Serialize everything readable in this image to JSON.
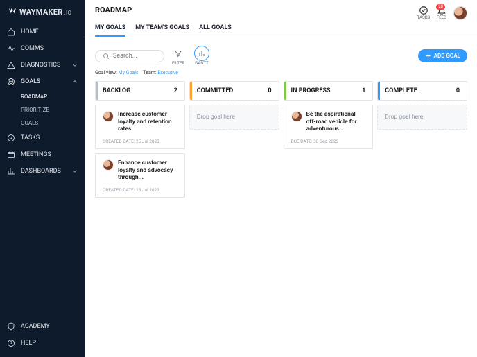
{
  "brand": {
    "name": "WAYMAKER",
    "suffix": ".IO"
  },
  "sidebar": {
    "items": [
      {
        "label": "HOME"
      },
      {
        "label": "COMMS"
      },
      {
        "label": "DIAGNOSTICS",
        "expandable": true,
        "open": false
      },
      {
        "label": "GOALS",
        "expandable": true,
        "open": true
      },
      {
        "label": "TASKS"
      },
      {
        "label": "MEETINGS"
      },
      {
        "label": "DASHBOARDS",
        "expandable": true,
        "open": false
      }
    ],
    "goals_sub": [
      {
        "label": "ROADMAP",
        "active": true
      },
      {
        "label": "PRIORITIZE"
      },
      {
        "label": "GOALS"
      }
    ],
    "footer": [
      {
        "label": "ACADEMY"
      },
      {
        "label": "HELP"
      }
    ]
  },
  "header": {
    "title": "ROADMAP",
    "actions": {
      "tasks_label": "TASKS",
      "feed_label": "FEED",
      "feed_badge": "28"
    }
  },
  "tabs": [
    {
      "label": "MY GOALS",
      "active": true
    },
    {
      "label": "MY TEAM'S GOALS"
    },
    {
      "label": "ALL GOALS"
    }
  ],
  "toolbar": {
    "search_placeholder": "Search...",
    "filter_label": "FILTER",
    "gantt_label": "GANTT",
    "add_goal_label": "ADD GOAL"
  },
  "meta": {
    "goal_view_label": "Goal view:",
    "goal_view_value": "My Goals",
    "team_label": "Team:",
    "team_value": "Executive"
  },
  "board": {
    "columns": [
      {
        "name": "BACKLOG",
        "count": 2
      },
      {
        "name": "COMMITTED",
        "count": 0,
        "drop_text": "Drop goal here"
      },
      {
        "name": "IN PROGRESS",
        "count": 1
      },
      {
        "name": "COMPLETE",
        "count": 0,
        "drop_text": "Drop goal here"
      }
    ],
    "backlog_cards": [
      {
        "title": "Increase customer loyalty and retention rates",
        "meta": "CREATED DATE: 25 Jul 2023"
      },
      {
        "title": "Enhance customer loyalty and advocacy through...",
        "meta": "CREATED DATE: 25 Jul 2023"
      }
    ],
    "inprogress_cards": [
      {
        "title": "Be the aspirational off-road vehicle for adventurous...",
        "meta": "DUE DATE: 30 Sep 2023"
      }
    ]
  }
}
